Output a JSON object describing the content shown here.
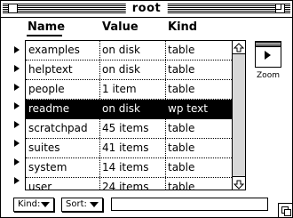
{
  "window": {
    "title": "root"
  },
  "columns": {
    "name": "Name",
    "value": "Value",
    "kind": "Kind"
  },
  "rows": [
    {
      "name": "examples",
      "value": "on disk",
      "kind": "table",
      "selected": false
    },
    {
      "name": "helptext",
      "value": "on disk",
      "kind": "table",
      "selected": false
    },
    {
      "name": "people",
      "value": "1 item",
      "kind": "table",
      "selected": false
    },
    {
      "name": "readme",
      "value": "on disk",
      "kind": "wp text",
      "selected": true
    },
    {
      "name": "scratchpad",
      "value": "45 items",
      "kind": "table",
      "selected": false
    },
    {
      "name": "suites",
      "value": "41 items",
      "kind": "table",
      "selected": false
    },
    {
      "name": "system",
      "value": "14 items",
      "kind": "table",
      "selected": false
    },
    {
      "name": "user",
      "value": "24 items",
      "kind": "table",
      "selected": false
    }
  ],
  "zoom": {
    "label": "Zoom"
  },
  "popups": {
    "kind_label": "Kind:",
    "sort_label": "Sort:"
  },
  "colors": {
    "selection_bg": "#000000",
    "selection_fg": "#ffffff",
    "scroll_track": "#d8d8d8"
  },
  "icons": {
    "disclosure": "disclosure-triangle-icon",
    "scroll_up": "arrow-up-icon",
    "scroll_down": "arrow-down-icon",
    "zoom": "zoom-window-icon",
    "grow": "grow-box-icon"
  }
}
